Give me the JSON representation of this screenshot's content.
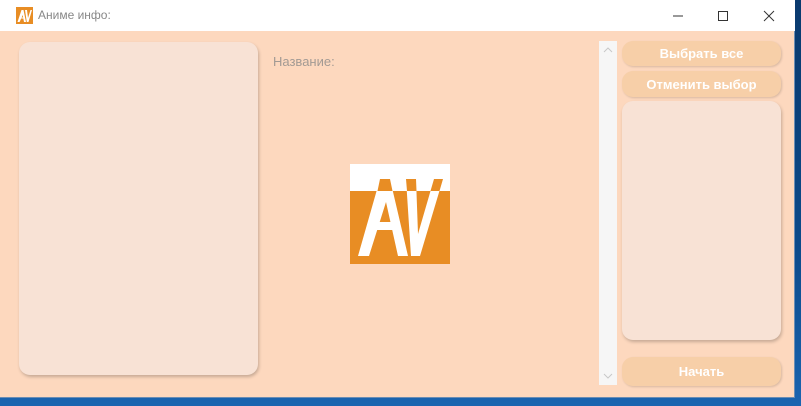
{
  "window": {
    "title": "Аниме инфо:",
    "icon": "app-av-logo-icon"
  },
  "title_controls": {
    "minimize_icon": "minimize-icon",
    "maximize_icon": "maximize-icon",
    "close_icon": "close-icon"
  },
  "main": {
    "name_label": "Название:",
    "logo": "av-logo"
  },
  "sidebar": {
    "select_all_label": "Выбрать все",
    "deselect_label": "Отменить выбор",
    "start_label": "Начать"
  },
  "colors": {
    "background": "#fdd8be",
    "panel": "#f8e2d5",
    "button": "#f7cfa8",
    "logo_orange": "#e88d24",
    "titlebar": "#ffffff"
  }
}
